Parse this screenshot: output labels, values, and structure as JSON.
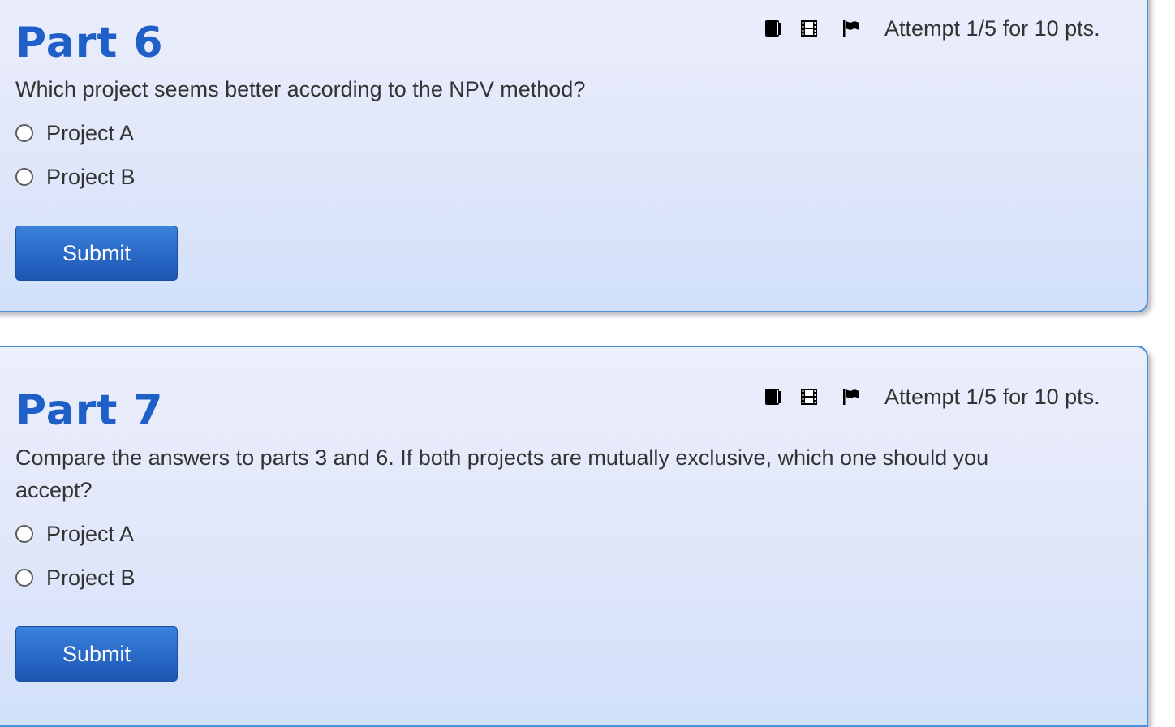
{
  "parts": [
    {
      "title": "Part 6",
      "attempt": "Attempt 1/5 for 10 pts.",
      "question": "Which project seems better according to the NPV method?",
      "options": [
        "Project A",
        "Project B"
      ],
      "submit_label": "Submit"
    },
    {
      "title": "Part 7",
      "attempt": "Attempt 1/5 for 10 pts.",
      "question": "Compare the answers to parts 3 and 6. If both projects are mutually exclusive, which one should you accept?",
      "options": [
        "Project A",
        "Project B"
      ],
      "submit_label": "Submit"
    }
  ],
  "icons": [
    "book-icon",
    "film-icon",
    "flag-icon"
  ],
  "colors": {
    "title": "#1e5fc8",
    "border": "#4a90d6",
    "button": "#2a6bc8"
  }
}
